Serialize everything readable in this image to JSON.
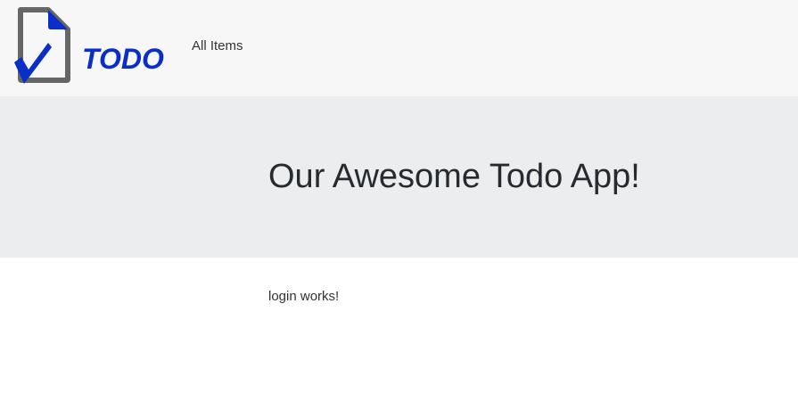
{
  "header": {
    "brand": {
      "logo_text": "TODO",
      "accent_color": "#0a2ec9",
      "outline_color": "#666666"
    },
    "nav": {
      "all_items_label": "All Items"
    }
  },
  "hero": {
    "title": "Our Awesome Todo App!"
  },
  "main": {
    "message": "login works!"
  }
}
